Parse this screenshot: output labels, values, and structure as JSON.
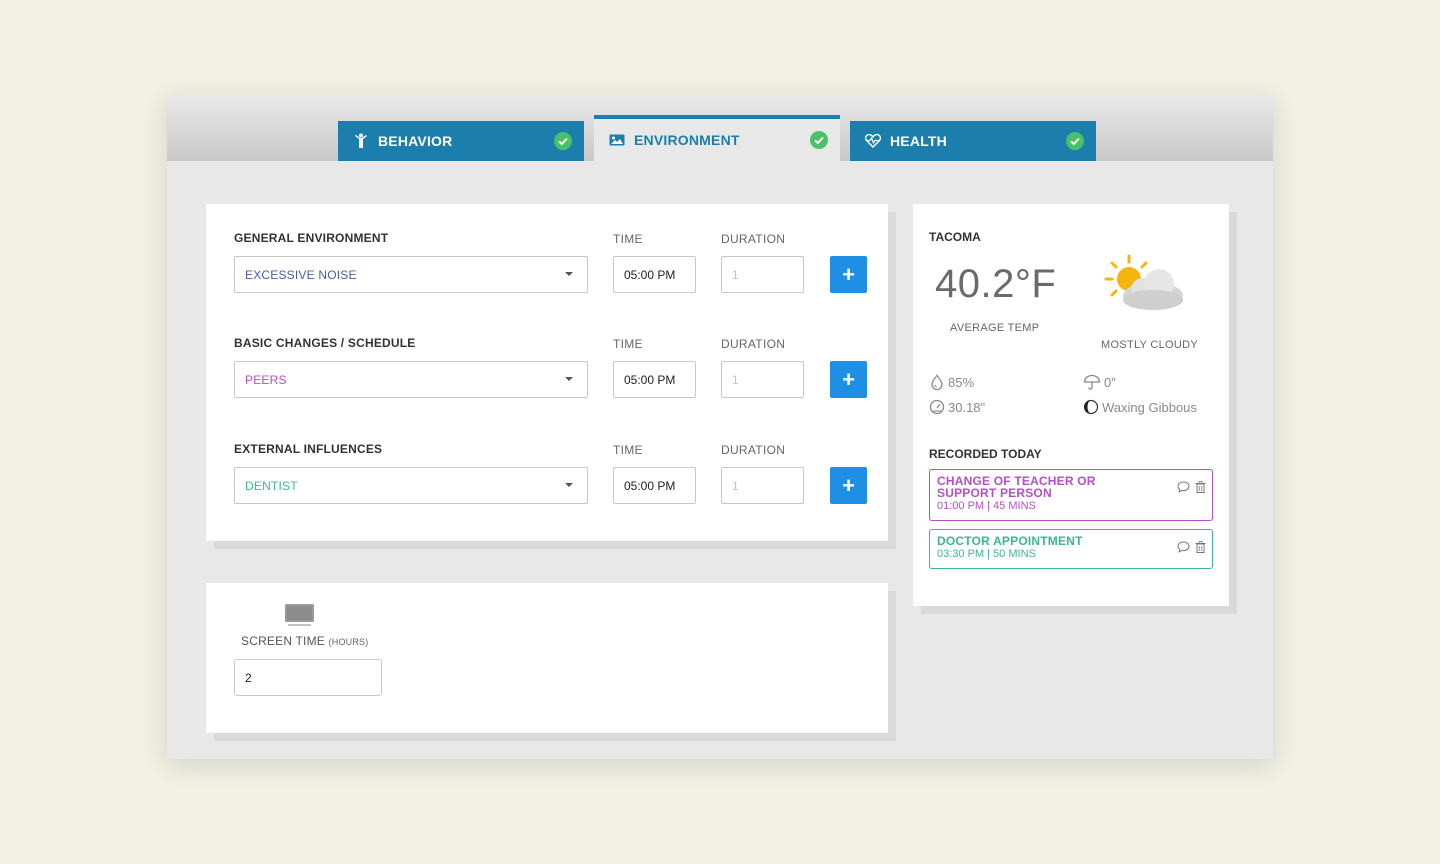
{
  "tabs": [
    {
      "label": "BEHAVIOR",
      "icon": "behavior-person-icon",
      "completed": true
    },
    {
      "label": "ENVIRONMENT",
      "icon": "image-icon",
      "completed": true,
      "active": true
    },
    {
      "label": "HEALTH",
      "icon": "heart-pulse-icon",
      "completed": true
    }
  ],
  "environment": {
    "time_label": "TIME",
    "duration_label": "DURATION",
    "add_label": "+",
    "rows": [
      {
        "label": "GENERAL ENVIRONMENT",
        "selected": "EXCESSIVE NOISE",
        "color": "#4b5aa8",
        "time": "05:00 PM",
        "duration_placeholder": "1"
      },
      {
        "label": "BASIC CHANGES / SCHEDULE",
        "selected": "PEERS",
        "color": "#b44fc6",
        "time": "05:00 PM",
        "duration_placeholder": "1"
      },
      {
        "label": "EXTERNAL INFLUENCES",
        "selected": "DENTIST",
        "color": "#3fb58f",
        "time": "05:00 PM",
        "duration_placeholder": "1"
      }
    ]
  },
  "screen_time": {
    "label": "SCREEN TIME",
    "unit": "(HOURS)",
    "value": "2"
  },
  "weather": {
    "city": "TACOMA",
    "temperature": "40.2°F",
    "avg_label": "AVERAGE TEMP",
    "condition": "MOSTLY CLOUDY",
    "humidity": "85%",
    "precipitation": "0\"",
    "pressure": "30.18\"",
    "moon_phase": "Waxing Gibbous"
  },
  "recorded": {
    "title": "RECORDED TODAY",
    "items": [
      {
        "title": "CHANGE OF TEACHER OR SUPPORT PERSON",
        "subtitle": "01:00 PM | 45 MINS",
        "color": "#b44fc6"
      },
      {
        "title": "DOCTOR APPOINTMENT",
        "subtitle": "03:30 PM | 50 MINS",
        "color": "#3fb58f"
      }
    ]
  }
}
